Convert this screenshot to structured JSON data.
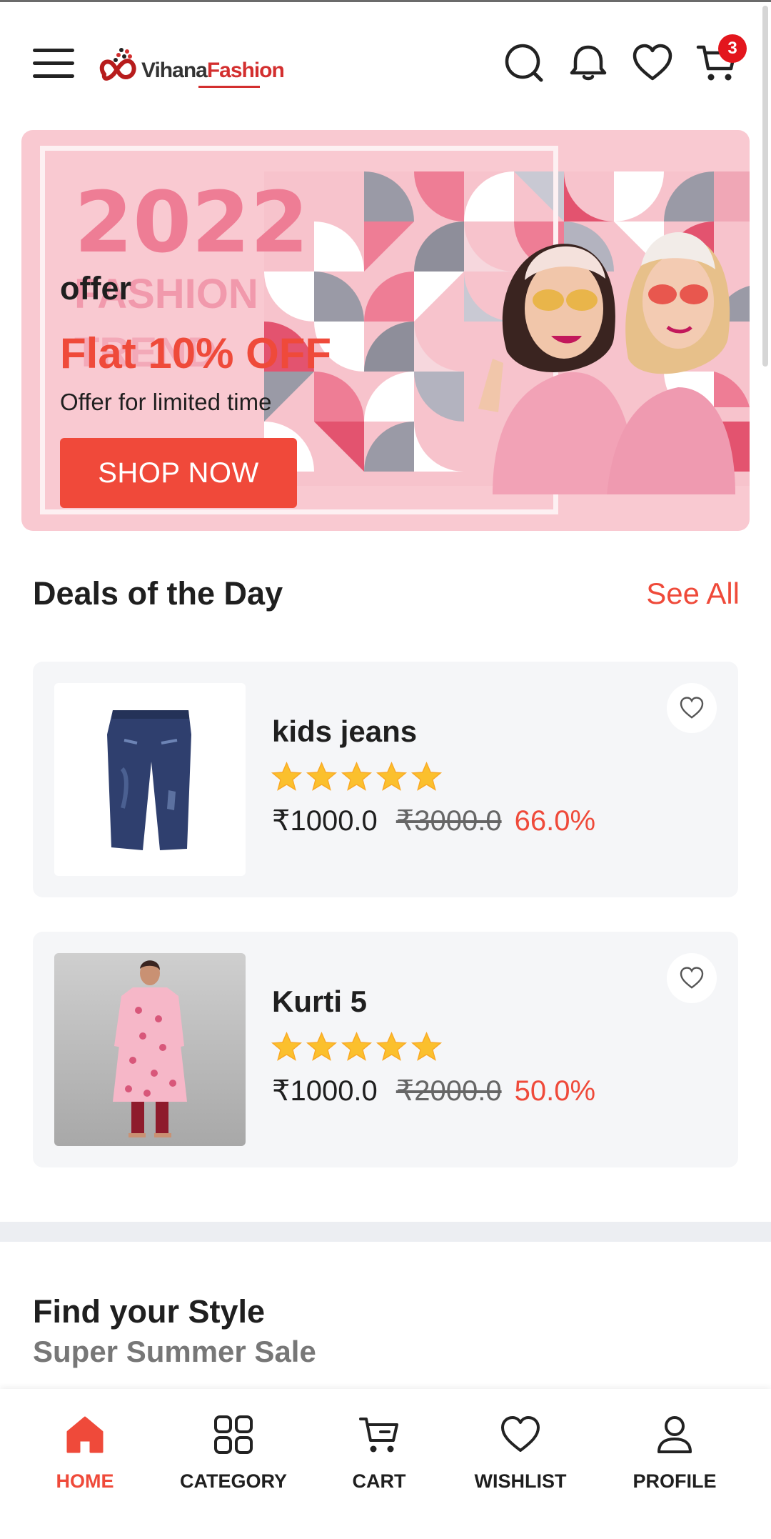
{
  "header": {
    "logo_primary": "Vihana",
    "logo_secondary": "Fashion",
    "cart_count": "3"
  },
  "banner": {
    "year_text": "2022",
    "ghost_line1": "FASHION",
    "ghost_line2": "TREND",
    "kicker": "offer",
    "title": "Flat 10% OFF",
    "subtitle": "Offer for limited time",
    "button": "SHOP NOW"
  },
  "deals": {
    "title": "Deals of the Day",
    "see_all": "See All",
    "products": [
      {
        "name": "kids jeans",
        "rating": 5,
        "price": "₹1000.0",
        "old_price": "₹3000.0",
        "discount": "66.0%"
      },
      {
        "name": "Kurti 5",
        "rating": 5,
        "price": "₹1000.0",
        "old_price": "₹2000.0",
        "discount": "50.0%"
      }
    ]
  },
  "style_section": {
    "title": "Find your Style",
    "subtitle": "Super Summer Sale"
  },
  "bottom_nav": {
    "items": [
      {
        "label": "HOME",
        "icon": "home-icon",
        "active": true
      },
      {
        "label": "CATEGORY",
        "icon": "grid-icon",
        "active": false
      },
      {
        "label": "CART",
        "icon": "cart-icon",
        "active": false
      },
      {
        "label": "WISHLIST",
        "icon": "heart-icon",
        "active": false
      },
      {
        "label": "PROFILE",
        "icon": "user-icon",
        "active": false
      }
    ]
  },
  "colors": {
    "accent": "#ef4a3a",
    "banner_bg": "#f9c9d1",
    "badge": "#e3161d",
    "card_bg": "#f5f6f8",
    "star": "#fbc02d"
  }
}
